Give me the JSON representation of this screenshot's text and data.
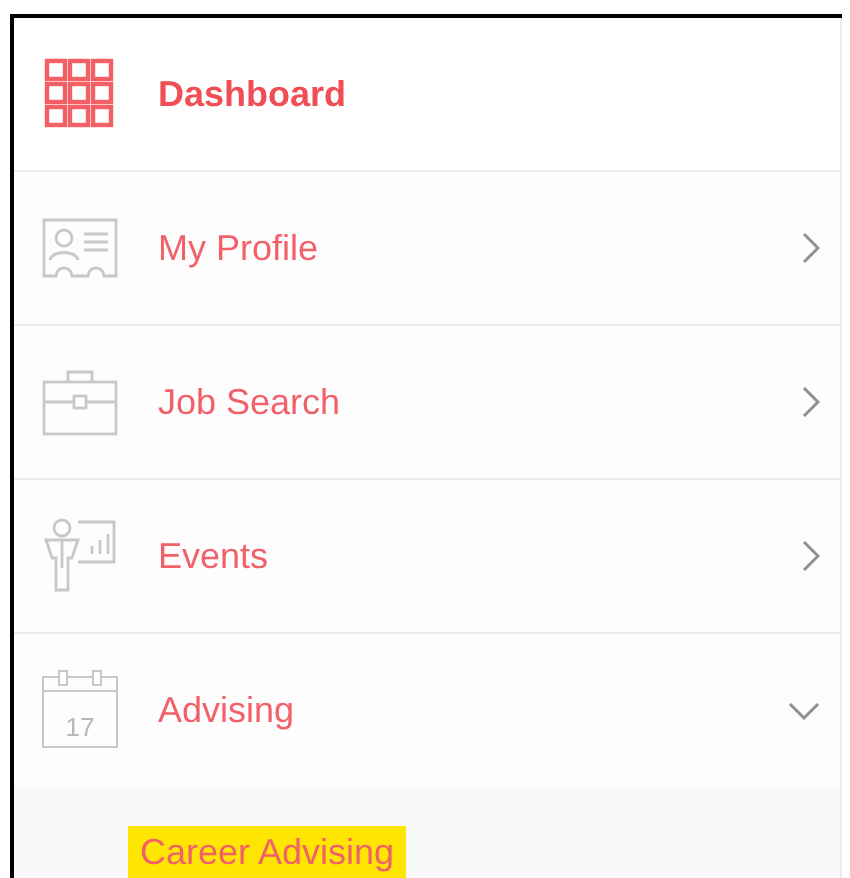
{
  "menu": {
    "items": [
      {
        "label": "Dashboard",
        "kind": "grid",
        "selected": true,
        "expandable": false
      },
      {
        "label": "My Profile",
        "kind": "profile",
        "selected": false,
        "expandable": true,
        "expanded": false
      },
      {
        "label": "Job Search",
        "kind": "briefcase",
        "selected": false,
        "expandable": true,
        "expanded": false
      },
      {
        "label": "Events",
        "kind": "presenter",
        "selected": false,
        "expandable": true,
        "expanded": false
      },
      {
        "label": "Advising",
        "kind": "calendar",
        "icon_text": "17",
        "selected": false,
        "expandable": true,
        "expanded": true,
        "children": [
          {
            "label": "Career Advising",
            "highlighted": true
          }
        ]
      }
    ]
  }
}
